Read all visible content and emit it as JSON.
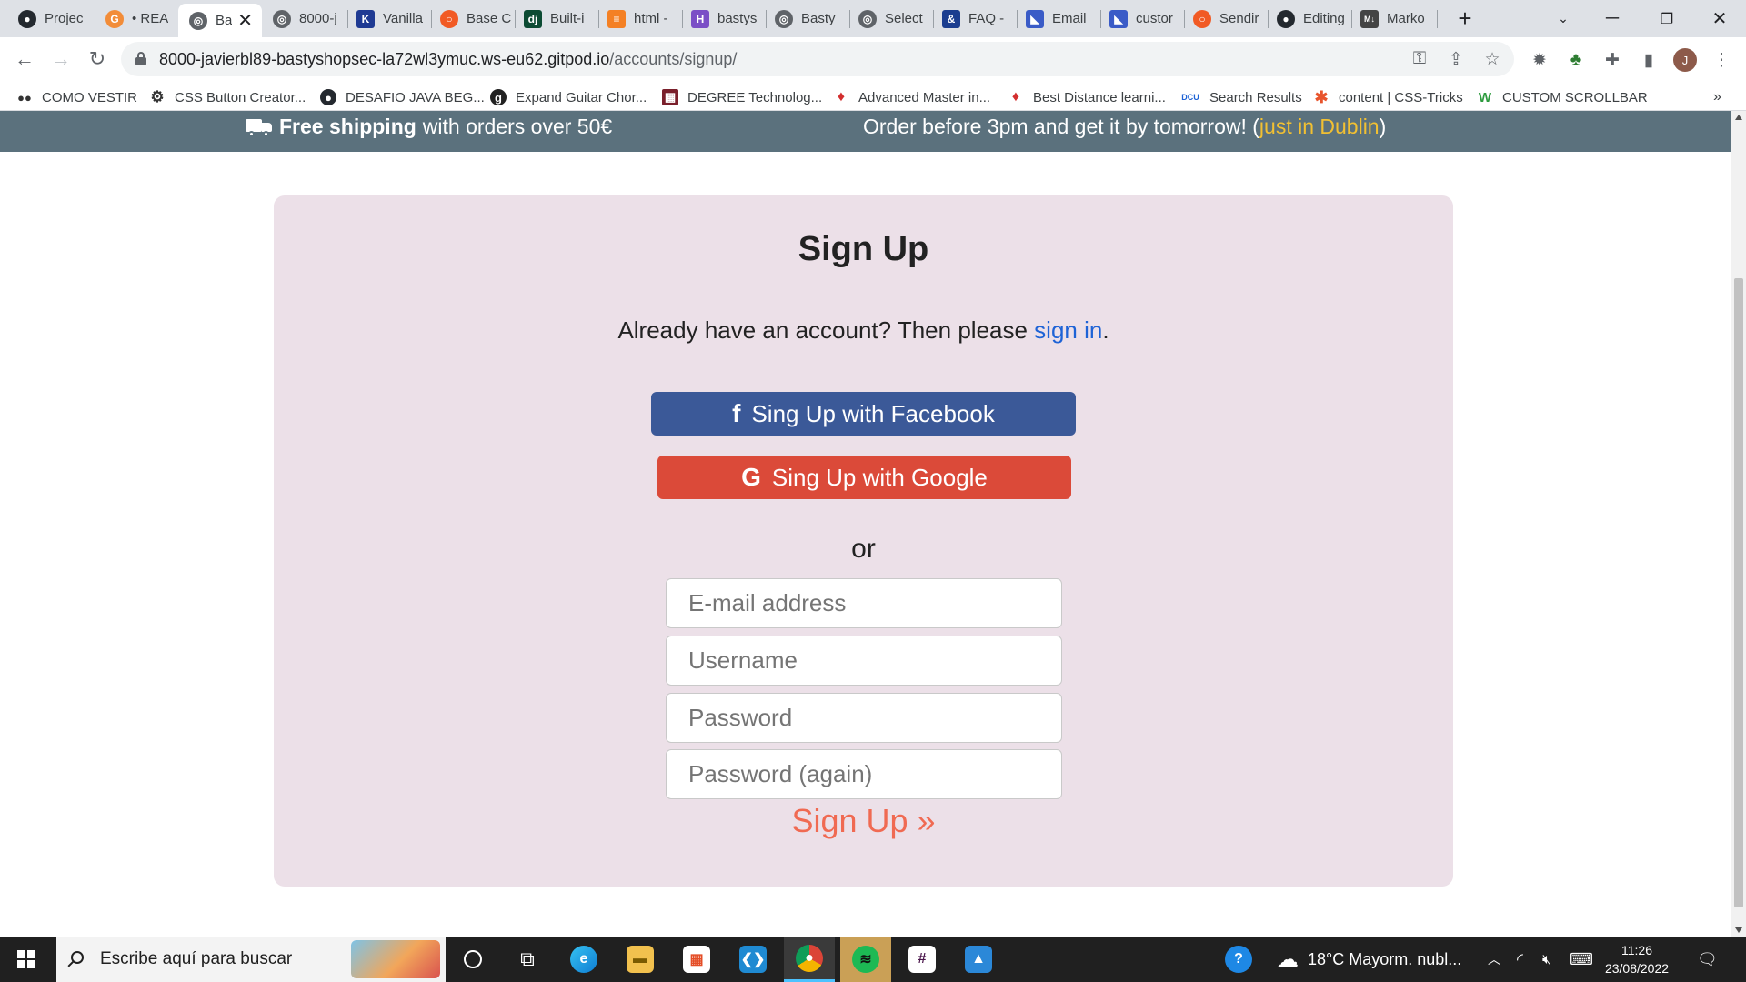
{
  "tabs": [
    {
      "title": "Projec",
      "icon": "github-icon",
      "color": "#24292f"
    },
    {
      "title": "• REA",
      "icon": "grammarly-icon",
      "color": "#f28c38"
    },
    {
      "title": "Ba",
      "icon": "globe-icon",
      "color": "#5f6368",
      "active": true
    },
    {
      "title": "8000-j",
      "icon": "globe-icon",
      "color": "#5f6368"
    },
    {
      "title": "Vanilla",
      "icon": "k-icon",
      "color": "#1f3a93"
    },
    {
      "title": "Base C",
      "icon": "circle-icon",
      "color": "#f15a24"
    },
    {
      "title": "Built-i",
      "icon": "django-icon",
      "color": "#0c4b33"
    },
    {
      "title": "html -",
      "icon": "stack-icon",
      "color": "#f48024"
    },
    {
      "title": "bastys",
      "icon": "h-icon",
      "color": "#7b4fc6"
    },
    {
      "title": "Basty",
      "icon": "globe-icon",
      "color": "#5f6368"
    },
    {
      "title": "Select",
      "icon": "globe-icon",
      "color": "#5f6368"
    },
    {
      "title": "FAQ -",
      "icon": "faq-icon",
      "color": "#1b3d8f"
    },
    {
      "title": "Email",
      "icon": "dev-icon",
      "color": "#3a5bc7"
    },
    {
      "title": "custor",
      "icon": "dev-icon",
      "color": "#3a5bc7"
    },
    {
      "title": "Sendir",
      "icon": "circle-icon",
      "color": "#f15a24"
    },
    {
      "title": "Editing",
      "icon": "github-icon",
      "color": "#24292f"
    },
    {
      "title": "Marko",
      "icon": "md-icon",
      "color": "#444"
    }
  ],
  "browser": {
    "new_tab_symbol": "+",
    "url_host": "8000-javierbl89-bastyshopsec-la72wl3ymuc.ws-eu62.gitpod.io",
    "url_path": "/accounts/signup/",
    "avatar_letter": "J"
  },
  "bookmarks": [
    {
      "label": "COMO VESTIR",
      "icon": "coco-icon"
    },
    {
      "label": "CSS Button Creator...",
      "icon": "gear-icon"
    },
    {
      "label": "DESAFIO JAVA BEG...",
      "icon": "github-icon"
    },
    {
      "label": "Expand Guitar Chor...",
      "icon": "g-icon"
    },
    {
      "label": "DEGREE Technolog...",
      "icon": "degree-icon"
    },
    {
      "label": "Advanced Master in...",
      "icon": "shield-icon"
    },
    {
      "label": "Best Distance learni...",
      "icon": "shield-icon"
    },
    {
      "label": "Search Results",
      "icon": "dcu-icon"
    },
    {
      "label": "content | CSS-Tricks",
      "icon": "star-icon"
    },
    {
      "label": "CUSTOM SCROLLBAR",
      "icon": "w-icon"
    }
  ],
  "bookmarks_overflow": "»",
  "banner": {
    "free_shipping": "Free shipping",
    "free_shipping_rest": "with orders over 50€",
    "order_text": "Order before 3pm and get it by tomorrow! (",
    "order_highlight": "just in Dublin",
    "order_close": ")"
  },
  "signup": {
    "title": "Sign Up",
    "already_text": "Already have an account? Then please ",
    "signin_link": "sign in",
    "period": ".",
    "facebook_label": "Sing Up with Facebook",
    "facebook_icon": "f",
    "google_label": "Sing Up with Google",
    "google_icon": "G",
    "or": "or",
    "email_placeholder": "E-mail address",
    "username_placeholder": "Username",
    "password_placeholder": "Password",
    "password2_placeholder": "Password (again)",
    "submit_label": "Sign Up »"
  },
  "taskbar": {
    "search_placeholder": "Escribe aquí para buscar",
    "weather": "18°C  Mayorm. nubl...",
    "time": "11:26",
    "date": "23/08/2022"
  },
  "colors": {
    "banner_bg": "#5b717d",
    "highlight": "#f2c032",
    "card_bg": "#ece0e8",
    "facebook": "#3b5998",
    "google": "#db4a39",
    "submit": "#f06a52",
    "link": "#1e63d6"
  }
}
